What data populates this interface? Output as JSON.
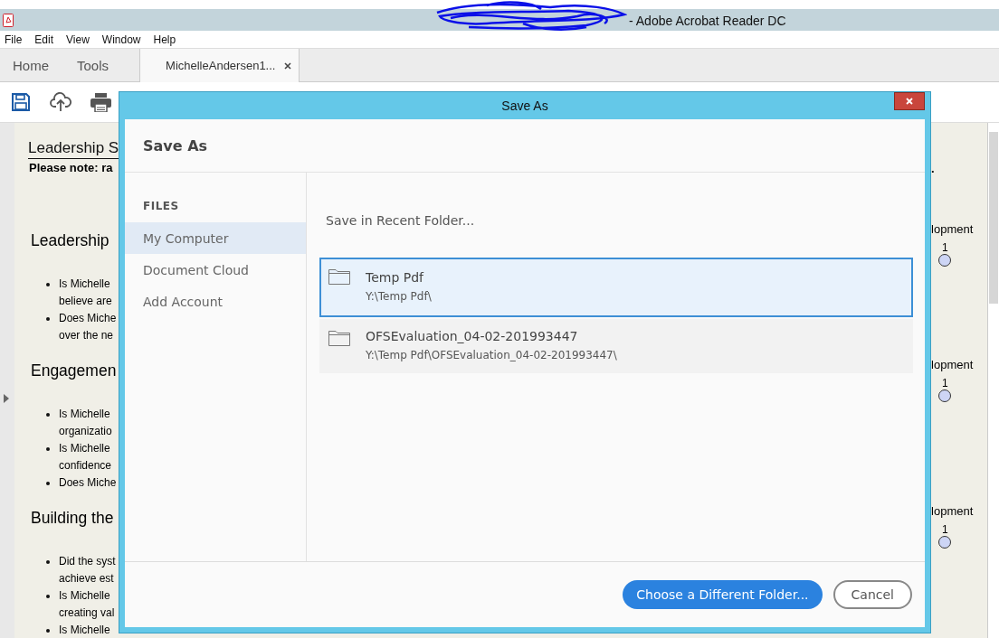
{
  "window": {
    "title": "- Adobe Acrobat Reader DC"
  },
  "menu": [
    "File",
    "Edit",
    "View",
    "Window",
    "Help"
  ],
  "tabs": [
    {
      "label": "Home",
      "selected": false,
      "kind": "nav"
    },
    {
      "label": "Tools",
      "selected": false,
      "kind": "nav"
    },
    {
      "label": "MichelleAndersen1...",
      "selected": true,
      "kind": "document"
    }
  ],
  "document": {
    "title": "Leadership S",
    "note": "Please note: ra",
    "sections": [
      {
        "heading": "Leadership",
        "items": [
          [
            "Is Michelle",
            "believe are"
          ],
          [
            "Does Miche",
            "over the ne"
          ]
        ]
      },
      {
        "heading": "Engagemen",
        "items": [
          [
            "Is Michelle",
            "organizatio"
          ],
          [
            "Is Michelle",
            "confidence"
          ],
          [
            "Does Miche"
          ]
        ]
      },
      {
        "heading": "Building the",
        "items": [
          [
            "Did the syst",
            "achieve est"
          ],
          [
            "Is Michelle",
            "creating val"
          ],
          [
            "Is Michelle"
          ]
        ]
      }
    ],
    "right_mark": ".",
    "right_columns": [
      {
        "label": "lopment",
        "value": "1",
        "selected": false
      },
      {
        "label": "lopment",
        "value": "1",
        "selected": false
      },
      {
        "label": "lopment",
        "value": "1",
        "selected": false
      }
    ]
  },
  "dialog": {
    "title": "Save As",
    "heading": "Save As",
    "section": "FILES",
    "locations": [
      {
        "label": "My Computer",
        "selected": true
      },
      {
        "label": "Document Cloud",
        "selected": false
      },
      {
        "label": "Add Account",
        "selected": false
      }
    ],
    "recent_label": "Save in Recent Folder...",
    "folders": [
      {
        "name": "Temp Pdf",
        "path": "Y:\\Temp Pdf\\",
        "selected": true
      },
      {
        "name": "OFSEvaluation_04-02-201993447",
        "path": "Y:\\Temp Pdf\\OFSEvaluation_04-02-201993447\\",
        "selected": false
      }
    ],
    "primary_button": "Choose a Different Folder...",
    "cancel_button": "Cancel"
  }
}
